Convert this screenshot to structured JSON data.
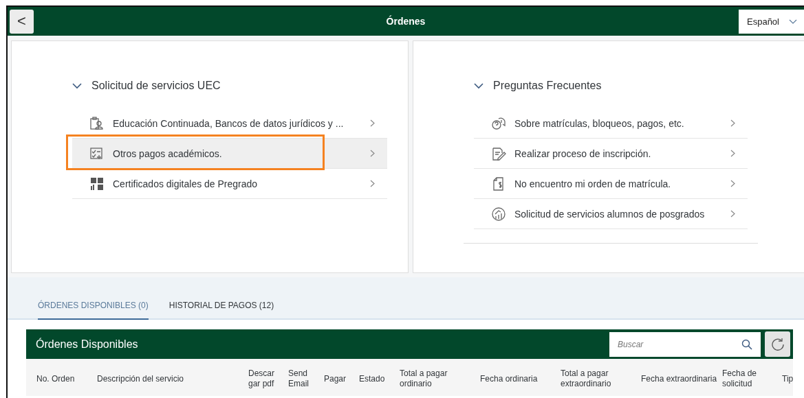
{
  "header": {
    "back": "<",
    "title": "Órdenes",
    "language": "Español"
  },
  "panels": [
    {
      "title": "Solicitud de servicios UEC",
      "expanded": true,
      "items": [
        {
          "label": "Educación Continuada, Bancos de datos jurídicos y ...",
          "selected": false,
          "highlighted": false
        },
        {
          "label": "Otros pagos académicos.",
          "selected": true,
          "highlighted": true
        },
        {
          "label": "Certificados digitales de Pregrado",
          "selected": false,
          "highlighted": false
        }
      ]
    },
    {
      "title": "Preguntas Frecuentes",
      "expanded": true,
      "items": [
        {
          "label": "Sobre matrículas, bloqueos, pagos, etc.",
          "selected": false,
          "highlighted": false
        },
        {
          "label": "Realizar proceso de inscripción.",
          "selected": false,
          "highlighted": false
        },
        {
          "label": "No encuentro mi orden de matrícula.",
          "selected": false,
          "highlighted": false
        },
        {
          "label": "Solicitud de servicios alumnos de posgrados",
          "selected": false,
          "highlighted": false
        }
      ]
    }
  ],
  "tabs": [
    {
      "label": "ÓRDENES DISPONIBLES (0)",
      "selected": true
    },
    {
      "label": "HISTORIAL DE PAGOS (12)",
      "selected": false
    }
  ],
  "table": {
    "title": "Órdenes Disponibles",
    "search": {
      "placeholder": "Buscar"
    },
    "columns": [
      "No. Orden",
      "Descripción del servicio",
      "Descar gar pdf",
      "Send Email",
      "Pagar",
      "Estado",
      "Total a pagar ordinario",
      "Fecha ordinaria",
      "Total a pagar extraordinario",
      "Fecha extraordinaria",
      "Fecha de solicitud",
      "Tip"
    ]
  }
}
